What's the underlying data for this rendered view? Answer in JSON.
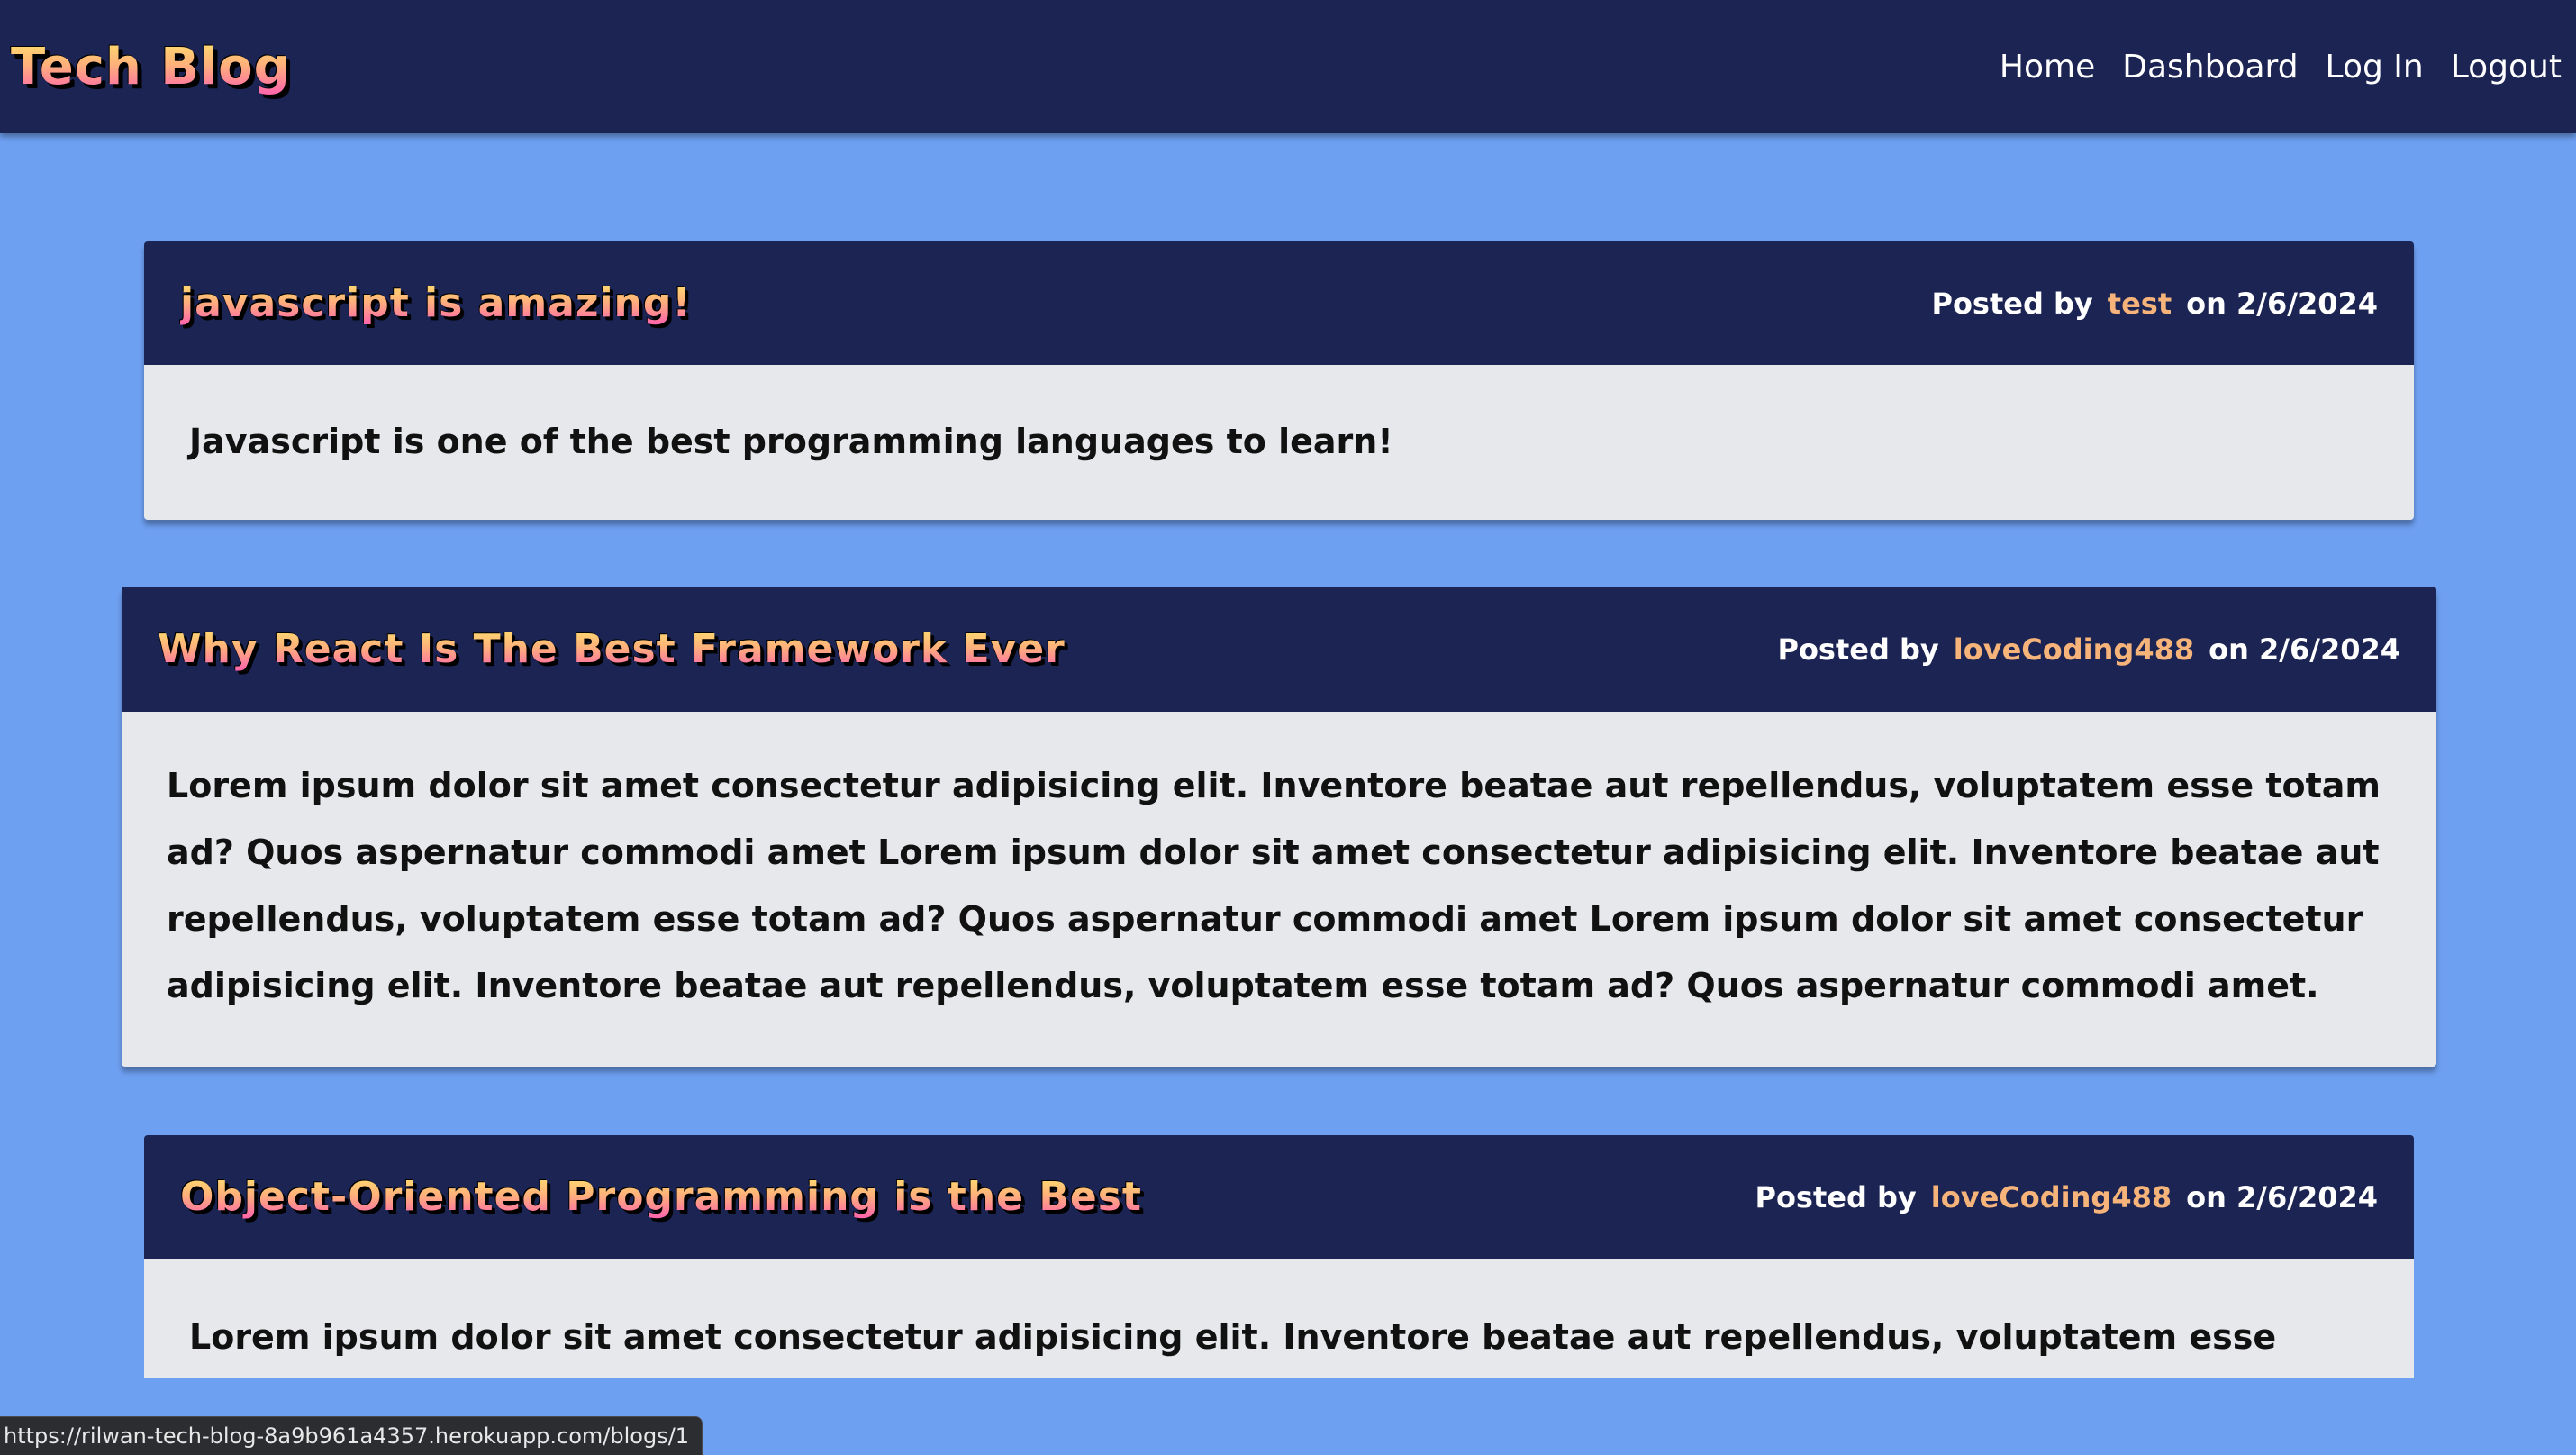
{
  "header": {
    "brand": "Tech Blog",
    "nav": [
      "Home",
      "Dashboard",
      "Log In",
      "Logout"
    ]
  },
  "posts": [
    {
      "title": "javascript is amazing!",
      "posted_by": "Posted by",
      "author": "test",
      "date": "on 2/6/2024",
      "body": "Javascript is one of the best programming languages to learn!"
    },
    {
      "title": "Why React Is The Best Framework Ever",
      "posted_by": "Posted by",
      "author": "loveCoding488",
      "date": "on 2/6/2024",
      "body": "Lorem ipsum dolor sit amet consectetur adipisicing elit. Inventore beatae aut repellendus, voluptatem esse totam ad? Quos aspernatur commodi amet Lorem ipsum dolor sit amet consectetur adipisicing elit. Inventore beatae aut repellendus, voluptatem esse totam ad? Quos aspernatur commodi amet Lorem ipsum dolor sit amet consectetur adipisicing elit. Inventore beatae aut repellendus, voluptatem esse totam ad? Quos aspernatur commodi amet."
    },
    {
      "title": "Object-Oriented Programming is the Best",
      "posted_by": "Posted by",
      "author": "loveCoding488",
      "date": "on 2/6/2024",
      "body": "Lorem ipsum dolor sit amet consectetur adipisicing elit. Inventore beatae aut repellendus, voluptatem esse totam"
    }
  ],
  "status_bar": {
    "url": "https://rilwan-tech-blog-8a9b961a4357.herokuapp.com/blogs/1"
  },
  "colors": {
    "background": "#6ea0f2",
    "header": "#1b2452",
    "card_body": "#e6e8ec",
    "author": "#f6b37a"
  }
}
